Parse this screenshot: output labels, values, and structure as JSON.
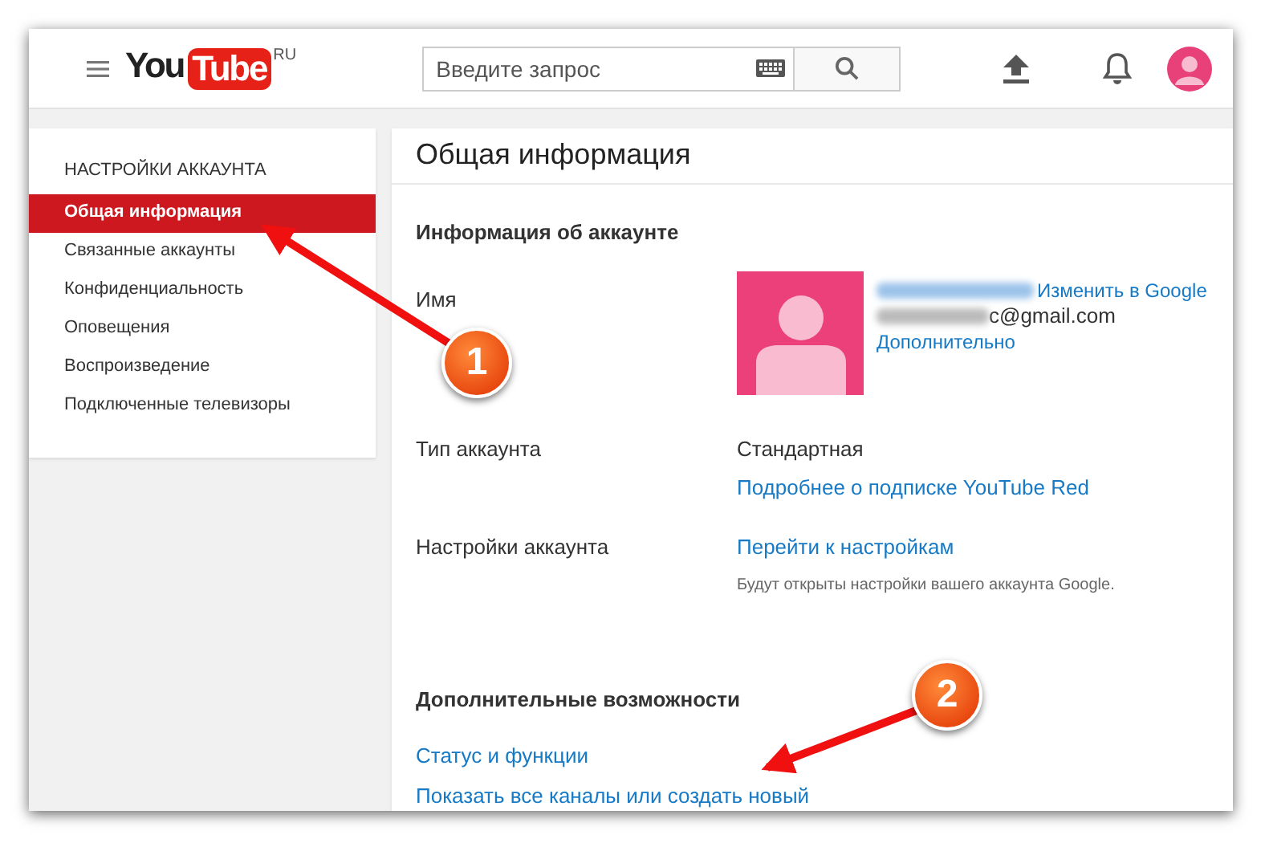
{
  "header": {
    "logo_you": "You",
    "logo_tube": "Tube",
    "region": "RU",
    "search": {
      "placeholder": "Введите запрос"
    }
  },
  "sidebar": {
    "heading": "НАСТРОЙКИ АККАУНТА",
    "items": [
      {
        "label": "Общая информация",
        "selected": true
      },
      {
        "label": "Связанные аккаунты",
        "selected": false
      },
      {
        "label": "Конфиденциальность",
        "selected": false
      },
      {
        "label": "Оповещения",
        "selected": false
      },
      {
        "label": "Воспроизведение",
        "selected": false
      },
      {
        "label": "Подключенные телевизоры",
        "selected": false
      }
    ]
  },
  "main": {
    "title": "Общая информация",
    "section": "Информация об аккаунте",
    "name_label": "Имя",
    "change_link": "Изменить в Google",
    "email_visible": "c@gmail.com",
    "more_link": "Дополнительно",
    "rows": [
      {
        "label": "Тип аккаунта",
        "value": "Стандартная",
        "link": "Подробнее о подписке YouTube Red"
      },
      {
        "label": "Настройки аккаунта",
        "link": "Перейти к настройкам",
        "note": "Будут открыты настройки вашего аккаунта Google."
      }
    ],
    "extra": {
      "heading": "Дополнительные возможности",
      "links": [
        "Статус и функции",
        "Показать все каналы или создать новый"
      ]
    }
  },
  "annotations": [
    {
      "number": "1"
    },
    {
      "number": "2"
    }
  ]
}
